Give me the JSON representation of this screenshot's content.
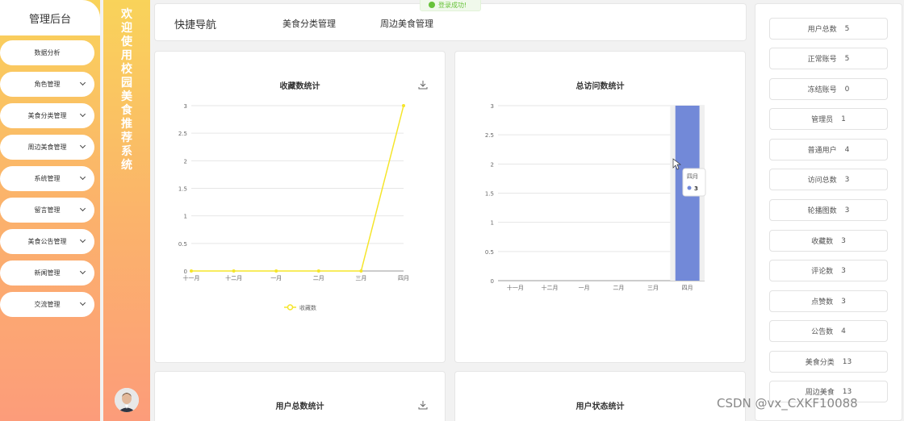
{
  "sidebar": {
    "brand": "管理后台",
    "items": [
      {
        "label": "数据分析",
        "has_arrow": false
      },
      {
        "label": "角色管理",
        "has_arrow": true
      },
      {
        "label": "美食分类管理",
        "has_arrow": true
      },
      {
        "label": "周边美食管理",
        "has_arrow": true
      },
      {
        "label": "系统管理",
        "has_arrow": true
      },
      {
        "label": "留言管理",
        "has_arrow": true
      },
      {
        "label": "美食公告管理",
        "has_arrow": true
      },
      {
        "label": "新闻管理",
        "has_arrow": true
      },
      {
        "label": "交流管理",
        "has_arrow": true
      }
    ]
  },
  "banner": {
    "title": "欢迎使用校园美食推荐系统"
  },
  "nav": {
    "title": "快捷导航",
    "links": [
      "美食分类管理",
      "周边美食管理"
    ]
  },
  "toast": {
    "text": "登录成功!"
  },
  "charts": {
    "favorites": {
      "title": "收藏数统计"
    },
    "visits": {
      "title": "总访问数统计"
    },
    "users": {
      "title": "用户总数统计"
    },
    "user_status": {
      "title": "用户状态统计"
    }
  },
  "chart_data": [
    {
      "type": "line",
      "title": "收藏数统计",
      "categories": [
        "十一月",
        "十二月",
        "一月",
        "二月",
        "三月",
        "四月"
      ],
      "series": [
        {
          "name": "收藏数",
          "values": [
            0,
            0,
            0,
            0,
            0,
            3
          ]
        }
      ],
      "ylim": [
        0,
        3
      ],
      "yticks": [
        0,
        0.5,
        1,
        1.5,
        2,
        2.5,
        3
      ],
      "legend": "bottom",
      "color": "#f5e52a"
    },
    {
      "type": "bar",
      "title": "总访问数统计",
      "categories": [
        "十一月",
        "十二月",
        "一月",
        "二月",
        "三月",
        "四月"
      ],
      "values": [
        0,
        0,
        0,
        0,
        0,
        3
      ],
      "ylim": [
        0,
        3
      ],
      "yticks": [
        0,
        0.5,
        1,
        1.5,
        2,
        2.5,
        3
      ],
      "color": "#7289d8",
      "tooltip": {
        "category": "四月",
        "value": "3"
      }
    }
  ],
  "stats": [
    {
      "label": "用户总数",
      "value": "5"
    },
    {
      "label": "正常账号",
      "value": "5"
    },
    {
      "label": "冻结账号",
      "value": "0"
    },
    {
      "label": "管理员",
      "value": "1"
    },
    {
      "label": "普通用户",
      "value": "4"
    },
    {
      "label": "访问总数",
      "value": "3"
    },
    {
      "label": "轮播图数",
      "value": "3"
    },
    {
      "label": "收藏数",
      "value": "3"
    },
    {
      "label": "评论数",
      "value": "3"
    },
    {
      "label": "点赞数",
      "value": "3"
    },
    {
      "label": "公告数",
      "value": "4"
    },
    {
      "label": "美食分类",
      "value": "13"
    },
    {
      "label": "周边美食",
      "value": "13"
    }
  ],
  "watermark": "CSDN @vx_CXKF10088",
  "colors": {
    "accent_top": "#f9d35a",
    "accent_bottom": "#fc9c7a"
  }
}
